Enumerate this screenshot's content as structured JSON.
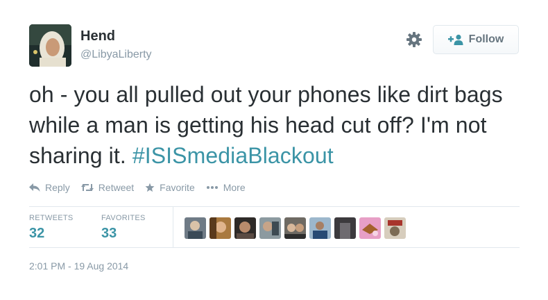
{
  "user": {
    "display_name": "Hend",
    "handle": "@LibyaLiberty",
    "avatar_icon": "profile-photo"
  },
  "header": {
    "settings_icon": "gear-icon",
    "follow_label": "Follow",
    "follow_icon": "add-user-icon"
  },
  "tweet": {
    "text_plain": "oh - you all pulled out your phones like dirt bags while a man is getting his head cut off? I'm not sharing it. ",
    "hashtag": "#ISISmediaBlackout"
  },
  "actions": [
    {
      "label": "Reply",
      "icon": "reply-icon"
    },
    {
      "label": "Retweet",
      "icon": "retweet-icon"
    },
    {
      "label": "Favorite",
      "icon": "star-icon"
    },
    {
      "label": "More",
      "icon": "more-icon"
    }
  ],
  "stats": {
    "retweets_label": "RETWEETS",
    "retweets_value": "32",
    "favorites_label": "FAVORITES",
    "favorites_value": "33"
  },
  "timestamp": "2:01 PM - 19 Aug 2014",
  "colors": {
    "text": "#292f33",
    "muted": "#8899a6",
    "accent": "#3b94a6",
    "border": "#e1e8ed"
  }
}
